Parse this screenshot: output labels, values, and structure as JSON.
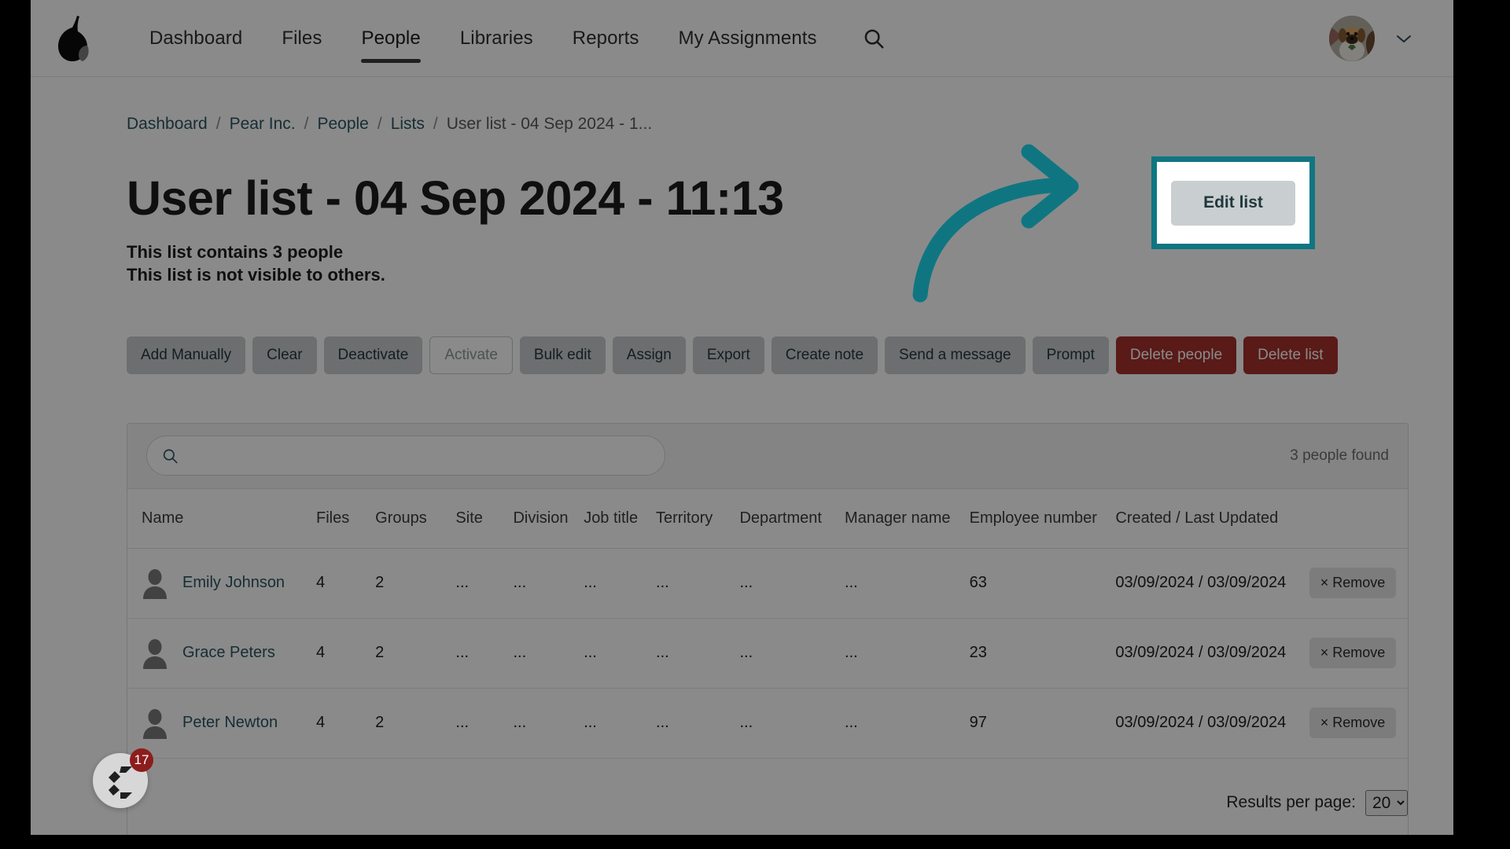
{
  "nav": {
    "logo_icon": "pear-logo-icon",
    "items": [
      {
        "label": "Dashboard",
        "active": false
      },
      {
        "label": "Files",
        "active": false
      },
      {
        "label": "People",
        "active": true
      },
      {
        "label": "Libraries",
        "active": false
      },
      {
        "label": "Reports",
        "active": false
      },
      {
        "label": "My Assignments",
        "active": false
      }
    ],
    "search_icon": "search-icon",
    "avatar_icon": "user-avatar-dog",
    "chevron_icon": "chevron-down-icon"
  },
  "breadcrumb": {
    "separator": "/",
    "items": [
      {
        "label": "Dashboard",
        "current": false
      },
      {
        "label": "Pear Inc.",
        "current": false
      },
      {
        "label": "People",
        "current": false
      },
      {
        "label": "Lists",
        "current": false
      },
      {
        "label": "User list - 04 Sep 2024 - 1...",
        "current": true
      }
    ]
  },
  "page": {
    "title": "User list - 04 Sep 2024 - 11:13",
    "subtitle_line1": "This list contains 3 people",
    "subtitle_line2": "This list is not visible to others."
  },
  "highlight": {
    "edit_list_label": "Edit list",
    "accent_color": "#0f7681",
    "arrow_icon": "curved-arrow-icon"
  },
  "actions": [
    {
      "label": "Add Manually",
      "style": "default"
    },
    {
      "label": "Clear",
      "style": "default"
    },
    {
      "label": "Deactivate",
      "style": "default"
    },
    {
      "label": "Activate",
      "style": "disabled"
    },
    {
      "label": "Bulk edit",
      "style": "default"
    },
    {
      "label": "Assign",
      "style": "default"
    },
    {
      "label": "Export",
      "style": "default"
    },
    {
      "label": "Create note",
      "style": "default"
    },
    {
      "label": "Send a message",
      "style": "default"
    },
    {
      "label": "Prompt",
      "style": "default"
    },
    {
      "label": "Delete people",
      "style": "danger"
    },
    {
      "label": "Delete list",
      "style": "danger"
    }
  ],
  "toolbar": {
    "search_placeholder": "",
    "search_value": "",
    "search_icon": "search-icon",
    "results_found": "3 people found"
  },
  "table": {
    "columns": [
      "Name",
      "Files",
      "Groups",
      "Site",
      "Division",
      "Job title",
      "Territory",
      "Department",
      "Manager name",
      "Employee number",
      "Created / Last Updated"
    ],
    "rows": [
      {
        "avatar_icon": "person-avatar-icon",
        "name": "Emily Johnson",
        "files": "4",
        "groups": "2",
        "site": "...",
        "division": "...",
        "job_title": "...",
        "territory": "...",
        "department": "...",
        "manager_name": "...",
        "employee_number": "63",
        "created_last_updated": "03/09/2024 / 03/09/2024",
        "remove_label": "× Remove"
      },
      {
        "avatar_icon": "person-avatar-icon",
        "name": "Grace Peters",
        "files": "4",
        "groups": "2",
        "site": "...",
        "division": "...",
        "job_title": "...",
        "territory": "...",
        "department": "...",
        "manager_name": "...",
        "employee_number": "23",
        "created_last_updated": "03/09/2024 / 03/09/2024",
        "remove_label": "× Remove"
      },
      {
        "avatar_icon": "person-avatar-icon",
        "name": "Peter Newton",
        "files": "4",
        "groups": "2",
        "site": "...",
        "division": "...",
        "job_title": "...",
        "territory": "...",
        "department": "...",
        "manager_name": "...",
        "employee_number": "97",
        "created_last_updated": "03/09/2024 / 03/09/2024",
        "remove_label": "× Remove"
      }
    ]
  },
  "footer": {
    "results_per_page_label": "Results per page:",
    "results_per_page_value": "20",
    "results_per_page_options": [
      "20"
    ]
  },
  "chat_widget": {
    "icon": "chat-logo-icon",
    "badge_count": "17"
  }
}
